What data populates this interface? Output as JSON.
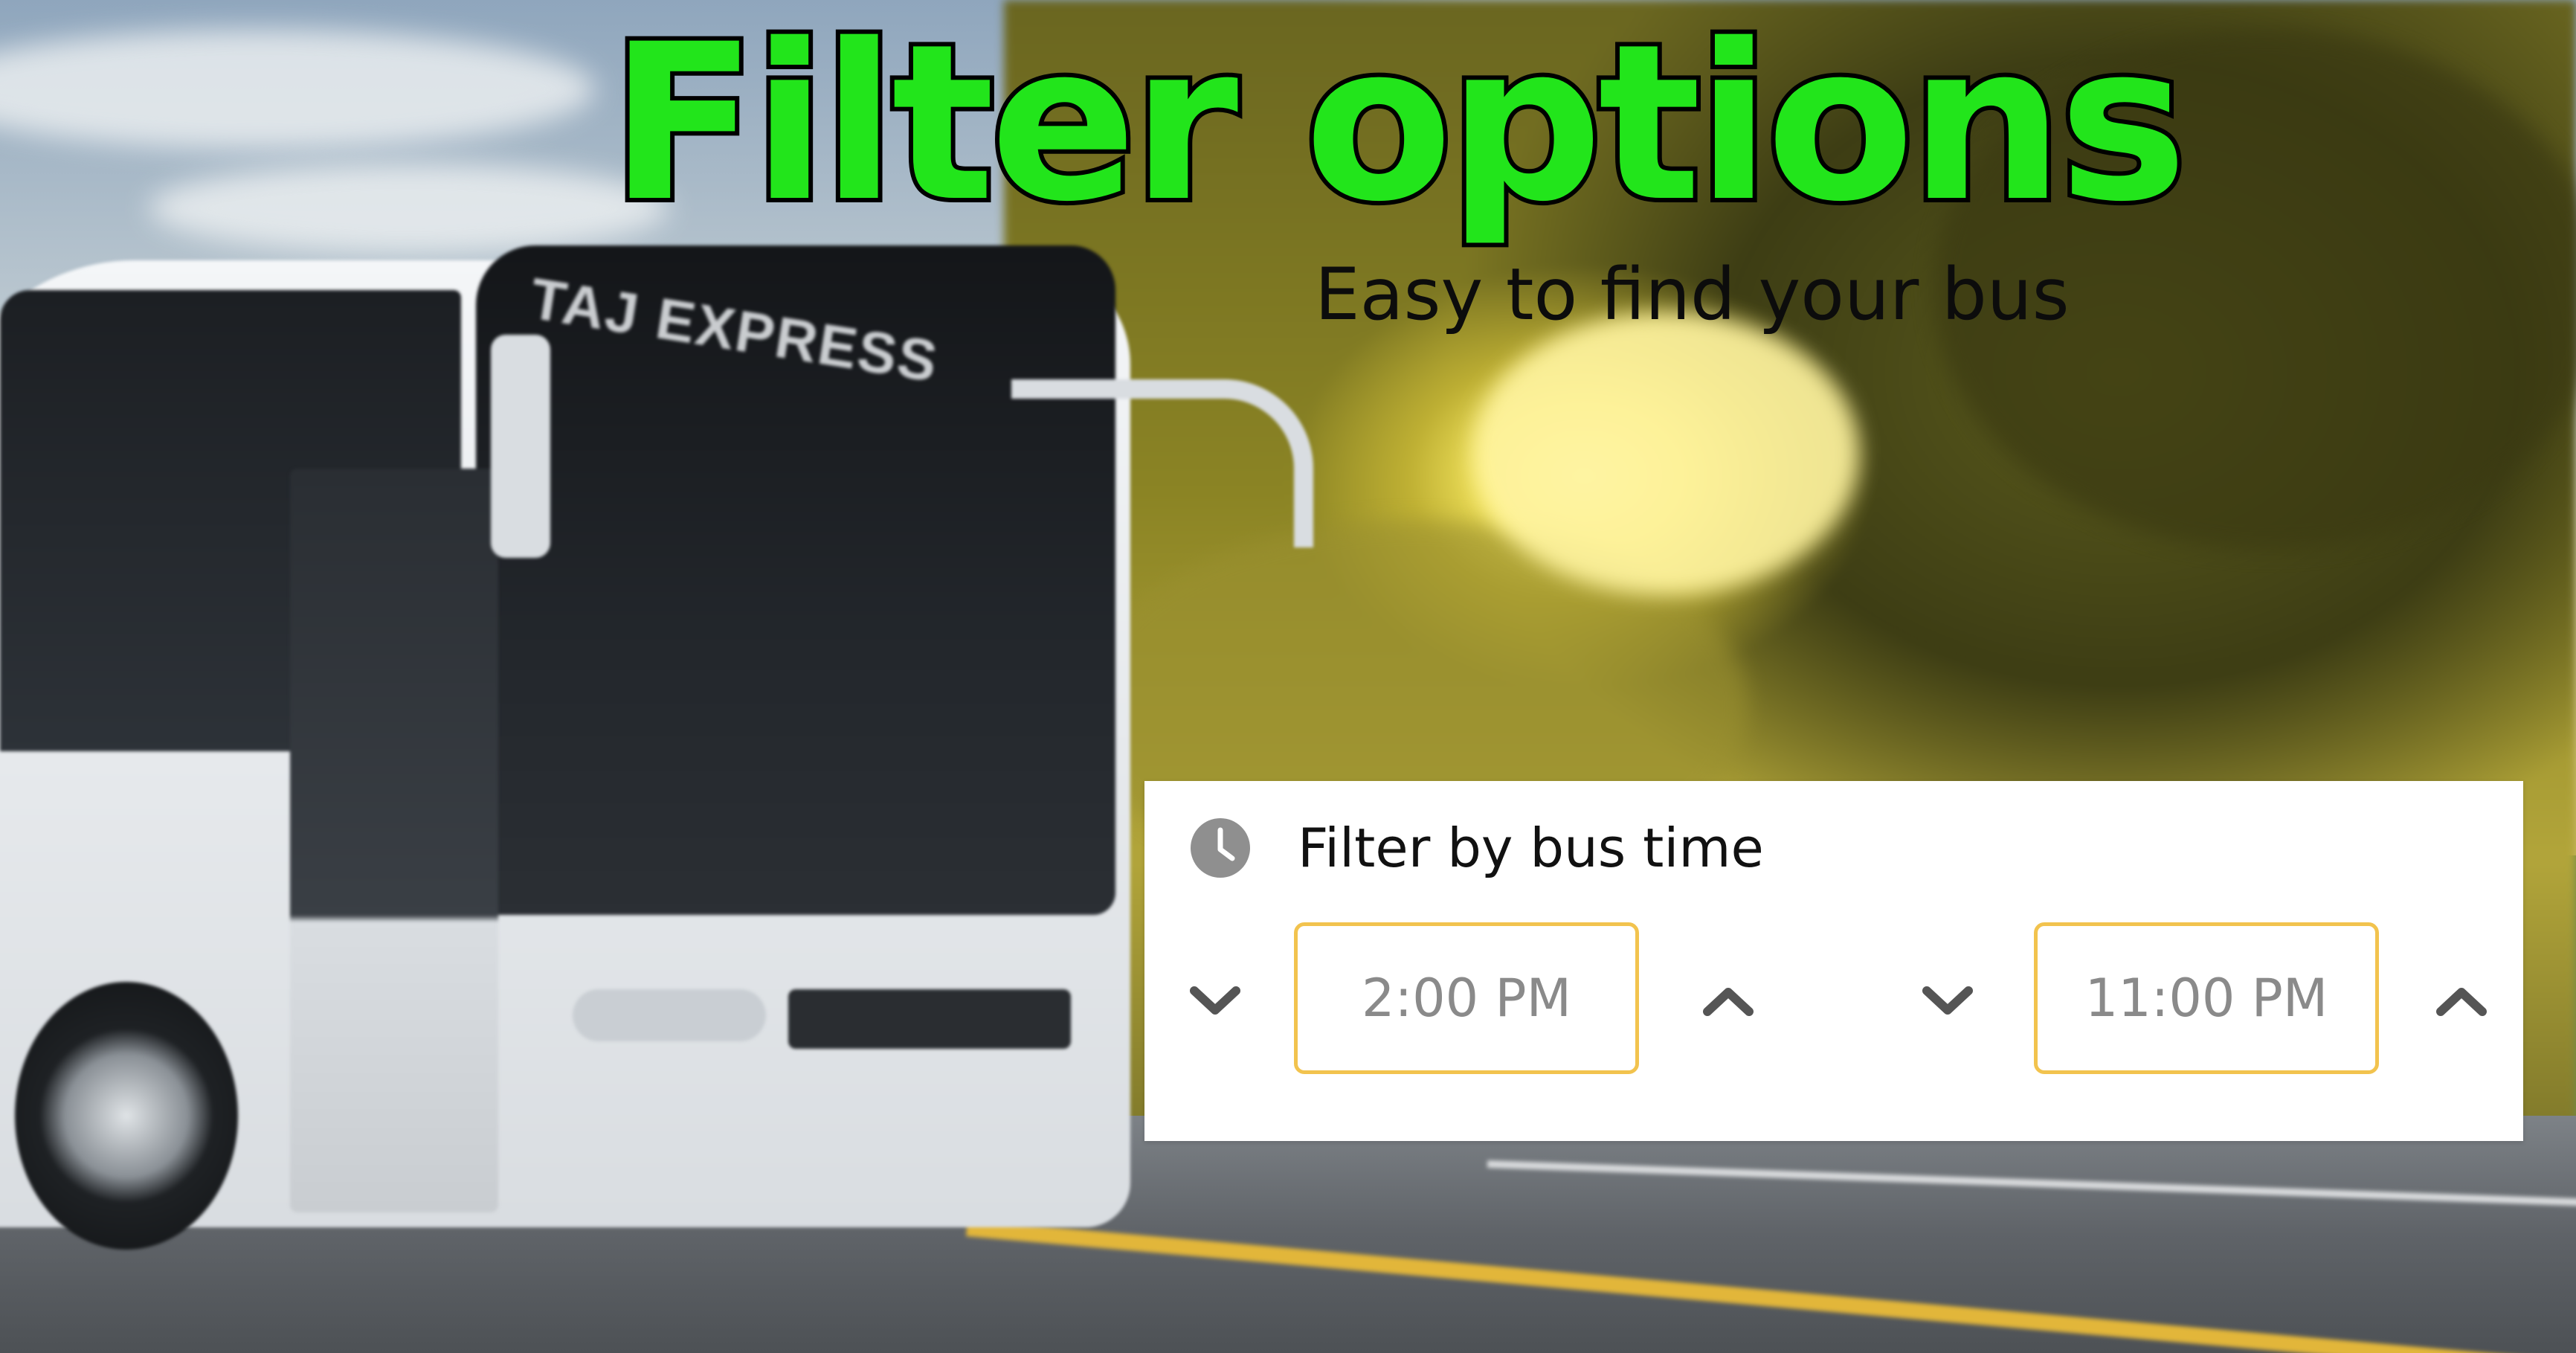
{
  "promo": {
    "headline": "Filter options",
    "subheadline": "Easy to find your bus",
    "bus_sign": "TAJ EXPRESS"
  },
  "filter": {
    "title": "Filter by bus time",
    "icon": "clock-icon",
    "start_time": "2:00 PM",
    "end_time": "11:00 PM",
    "accent_color": "#f2c34e"
  },
  "colors": {
    "headline_fill": "#22e51b",
    "headline_stroke": "#000000"
  }
}
